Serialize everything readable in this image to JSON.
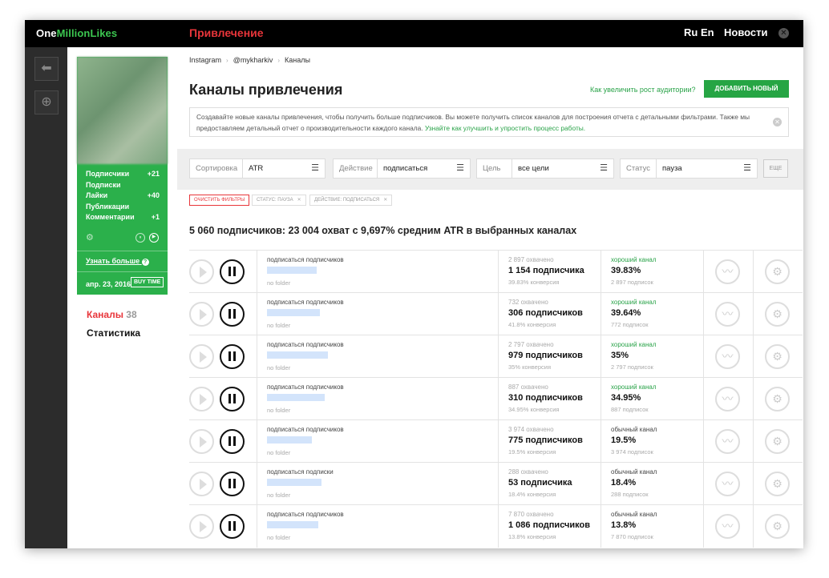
{
  "topbar": {
    "logo_a": "One",
    "logo_b": "MillionLikes",
    "section": "Привлечение",
    "lang": "Ru En",
    "news": "Новости",
    "close_glyph": "✕"
  },
  "rail": {
    "back_glyph": "⬅",
    "add_glyph": "⊕"
  },
  "profile": {
    "stats": [
      {
        "label": "Подписчики",
        "value": "+21"
      },
      {
        "label": "Подписки",
        "value": ""
      },
      {
        "label": "Лайки",
        "value": "+40"
      },
      {
        "label": "Публикации",
        "value": ""
      },
      {
        "label": "Комментарии",
        "value": "+1"
      }
    ],
    "gear_glyph": "⚙",
    "pause_glyph": "⏸",
    "play_glyph": "▶",
    "learn_more": "Узнать больше",
    "help_glyph": "?",
    "date": "апр. 23, 2016",
    "buy_time": "BUY TIME"
  },
  "menu": {
    "channels": "Каналы",
    "channels_count": "38",
    "stats": "Статистика"
  },
  "breadcrumbs": [
    "Instagram",
    "@mykharkiv",
    "Каналы"
  ],
  "header": {
    "title": "Каналы привлечения",
    "grow_link": "Как увеличить рост аудитории?",
    "add_button": "ДОБАВИТЬ НОВЫЙ КАНАЛ"
  },
  "info": {
    "text": "Создавайте новые каналы привлечения, чтобы получить больше подписчиков. Вы можете получить список каналов для построения отчета с детальными фильтрами. Также мы предоставляем детальный отчет о производительности каждого канала.",
    "link": "Узнайте как улучшить и упростить процесс работы."
  },
  "filters": {
    "sort_label": "Сортировка",
    "sort_value": "ATR",
    "action_label": "Действие",
    "action_value": "подписаться",
    "goal_label": "Цель",
    "goal_value": "все цели",
    "status_label": "Статус",
    "status_value": "пауза",
    "more_button": "ЕЩЕ",
    "menu_glyph": "☰"
  },
  "chips": {
    "clear": "ОЧИСТИТЬ ФИЛЬТРЫ",
    "status": "СТАТУС: ПАУЗА",
    "action": "ДЕЙСТВИЕ: ПОДПИСАТЬСЯ",
    "x_glyph": "✕"
  },
  "summary": "5 060 подписчиков: 23 004 охват с 9,697% средним ATR в выбранных каналах",
  "rows": [
    {
      "action": "подписаться подписчиков",
      "folder": "no folder",
      "reach": "2 897 охвачено",
      "subs": "1 154 подписчика",
      "conv": "39.83% конверсия",
      "quality": "хороший канал",
      "qclass": "good",
      "atr": "39.83%",
      "qsubs": "2 897 подписок",
      "blur": 62
    },
    {
      "action": "подписаться подписчиков",
      "folder": "no folder",
      "reach": "732 охвачено",
      "subs": "306 подписчиков",
      "conv": "41.8% конверсия",
      "quality": "хороший канал",
      "qclass": "good",
      "atr": "39.64%",
      "qsubs": "772 подписок",
      "blur": 66
    },
    {
      "action": "подписаться подписчиков",
      "folder": "no folder",
      "reach": "2 797 охвачено",
      "subs": "979 подписчиков",
      "conv": "35% конверсия",
      "quality": "хороший канал",
      "qclass": "good",
      "atr": "35%",
      "qsubs": "2 797 подписок",
      "blur": 76
    },
    {
      "action": "подписаться подписчиков",
      "folder": "no folder",
      "reach": "887 охвачено",
      "subs": "310 подписчиков",
      "conv": "34.95% конверсия",
      "quality": "хороший канал",
      "qclass": "good",
      "atr": "34.95%",
      "qsubs": "887 подписок",
      "blur": 72
    },
    {
      "action": "подписаться подписчиков",
      "folder": "no folder",
      "reach": "3 974 охвачено",
      "subs": "775 подписчиков",
      "conv": "19.5% конверсия",
      "quality": "обычный канал",
      "qclass": "norm",
      "atr": "19.5%",
      "qsubs": "3 974 подписок",
      "blur": 56
    },
    {
      "action": "подписаться подписки",
      "folder": "no folder",
      "reach": "288 охвачено",
      "subs": "53 подписчика",
      "conv": "18.4% конверсия",
      "quality": "обычный канал",
      "qclass": "norm",
      "atr": "18.4%",
      "qsubs": "288 подписок",
      "blur": 68
    },
    {
      "action": "подписаться подписчиков",
      "folder": "no folder",
      "reach": "7 870 охвачено",
      "subs": "1 086 подписчиков",
      "conv": "13.8% конверсия",
      "quality": "обычный канал",
      "qclass": "norm",
      "atr": "13.8%",
      "qsubs": "7 870 подписок",
      "blur": 64
    }
  ],
  "row_icons": {
    "chart_glyph": "〰",
    "gear_glyph": "⚙"
  }
}
